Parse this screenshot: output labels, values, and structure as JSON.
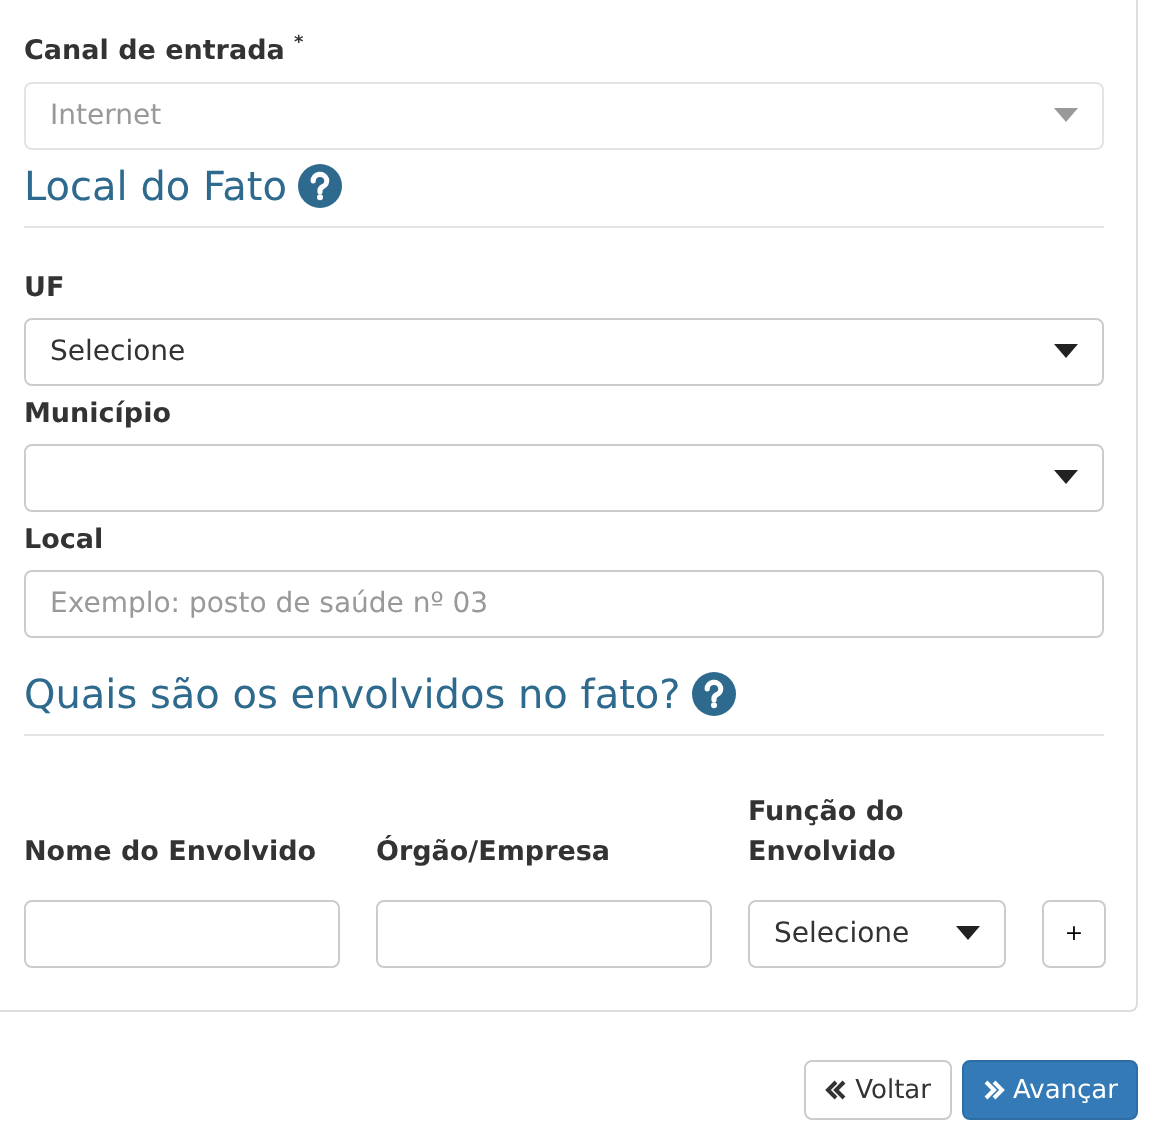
{
  "canal_de_entrada": {
    "label": "Canal de entrada $^{*}$",
    "value": "Internet",
    "disabled": true
  },
  "local_do_fato": {
    "title": "Local do Fato",
    "fields": [
      {
        "kind": "select",
        "label": "UF",
        "value": "Selecione"
      },
      {
        "kind": "select",
        "label": "Município"
      },
      {
        "kind": "input",
        "label": "Local",
        "placeholder": "Exemplo: posto de saúde nº 03"
      }
    ]
  },
  "envolvidos": {
    "title": "Quais são os envolvidos no fato?",
    "columns": [
      "Nome do Envolvido",
      "Órgão/Empresa",
      "Função do Envolvido"
    ],
    "row": [
      {
        "kind": "input"
      },
      {
        "kind": "input"
      },
      {
        "kind": "select",
        "value": "Selecione"
      }
    ],
    "add_button": "+"
  },
  "buttons": [
    {
      "kind": "back",
      "label": "Voltar"
    },
    {
      "kind": "next",
      "label": "Avançar"
    }
  ]
}
